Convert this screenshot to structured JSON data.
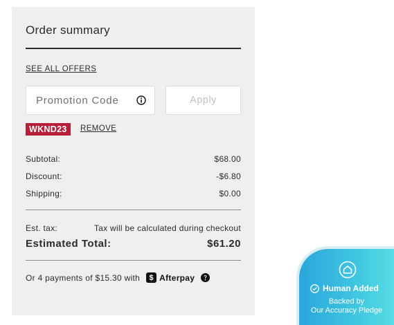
{
  "summary": {
    "title": "Order summary",
    "see_offers": "SEE ALL OFFERS",
    "promo_placeholder": "Promotion Code",
    "apply_label": "Apply",
    "applied_code": "WKND23",
    "remove_label": "REMOVE",
    "lines": [
      {
        "label": "Subtotal:",
        "value": "$68.00"
      },
      {
        "label": "Discount:",
        "value": "-$6.80"
      },
      {
        "label": "Shipping:",
        "value": "$0.00"
      }
    ],
    "tax_label": "Est. tax:",
    "tax_note": "Tax will be calculated during checkout",
    "total_label": "Estimated Total:",
    "total_value": "$61.20",
    "installments_text": "Or 4 payments of $15.30 with",
    "afterpay_label": "Afterpay"
  },
  "pledge": {
    "title": "Human Added",
    "line1": "Backed by",
    "line2": "Our Accuracy Pledge"
  },
  "colors": {
    "panel_bg": "#f0efed",
    "code_badge": "#b61e39",
    "pledge_gradient_start": "#2aa6dc",
    "pledge_gradient_end": "#57dde3"
  },
  "icons": [
    "info-icon",
    "help-icon",
    "afterpay-logo-icon",
    "home-icon",
    "check-circle-icon"
  ]
}
